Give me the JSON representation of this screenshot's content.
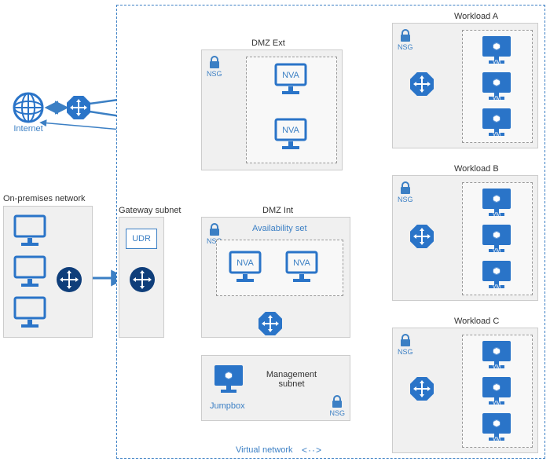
{
  "internet": {
    "label": "Internet"
  },
  "onprem": {
    "title": "On-premises network"
  },
  "gateway_subnet": {
    "title": "Gateway subnet",
    "udr": "UDR"
  },
  "virtual_network": {
    "label": "Virtual network",
    "toggle": "<··>"
  },
  "nsg_label": "NSG",
  "dmz_ext": {
    "title": "DMZ Ext",
    "nva1": "NVA",
    "nva2": "NVA"
  },
  "dmz_int": {
    "title": "DMZ Int",
    "avset_label": "Availability set",
    "nva1": "NVA",
    "nva2": "NVA"
  },
  "management_subnet": {
    "title": "Management subnet",
    "jumpbox_caption": "Jumpbox"
  },
  "vm_label": "VM",
  "workloads": {
    "a": {
      "title": "Workload A"
    },
    "b": {
      "title": "Workload B"
    },
    "c": {
      "title": "Workload C"
    }
  }
}
